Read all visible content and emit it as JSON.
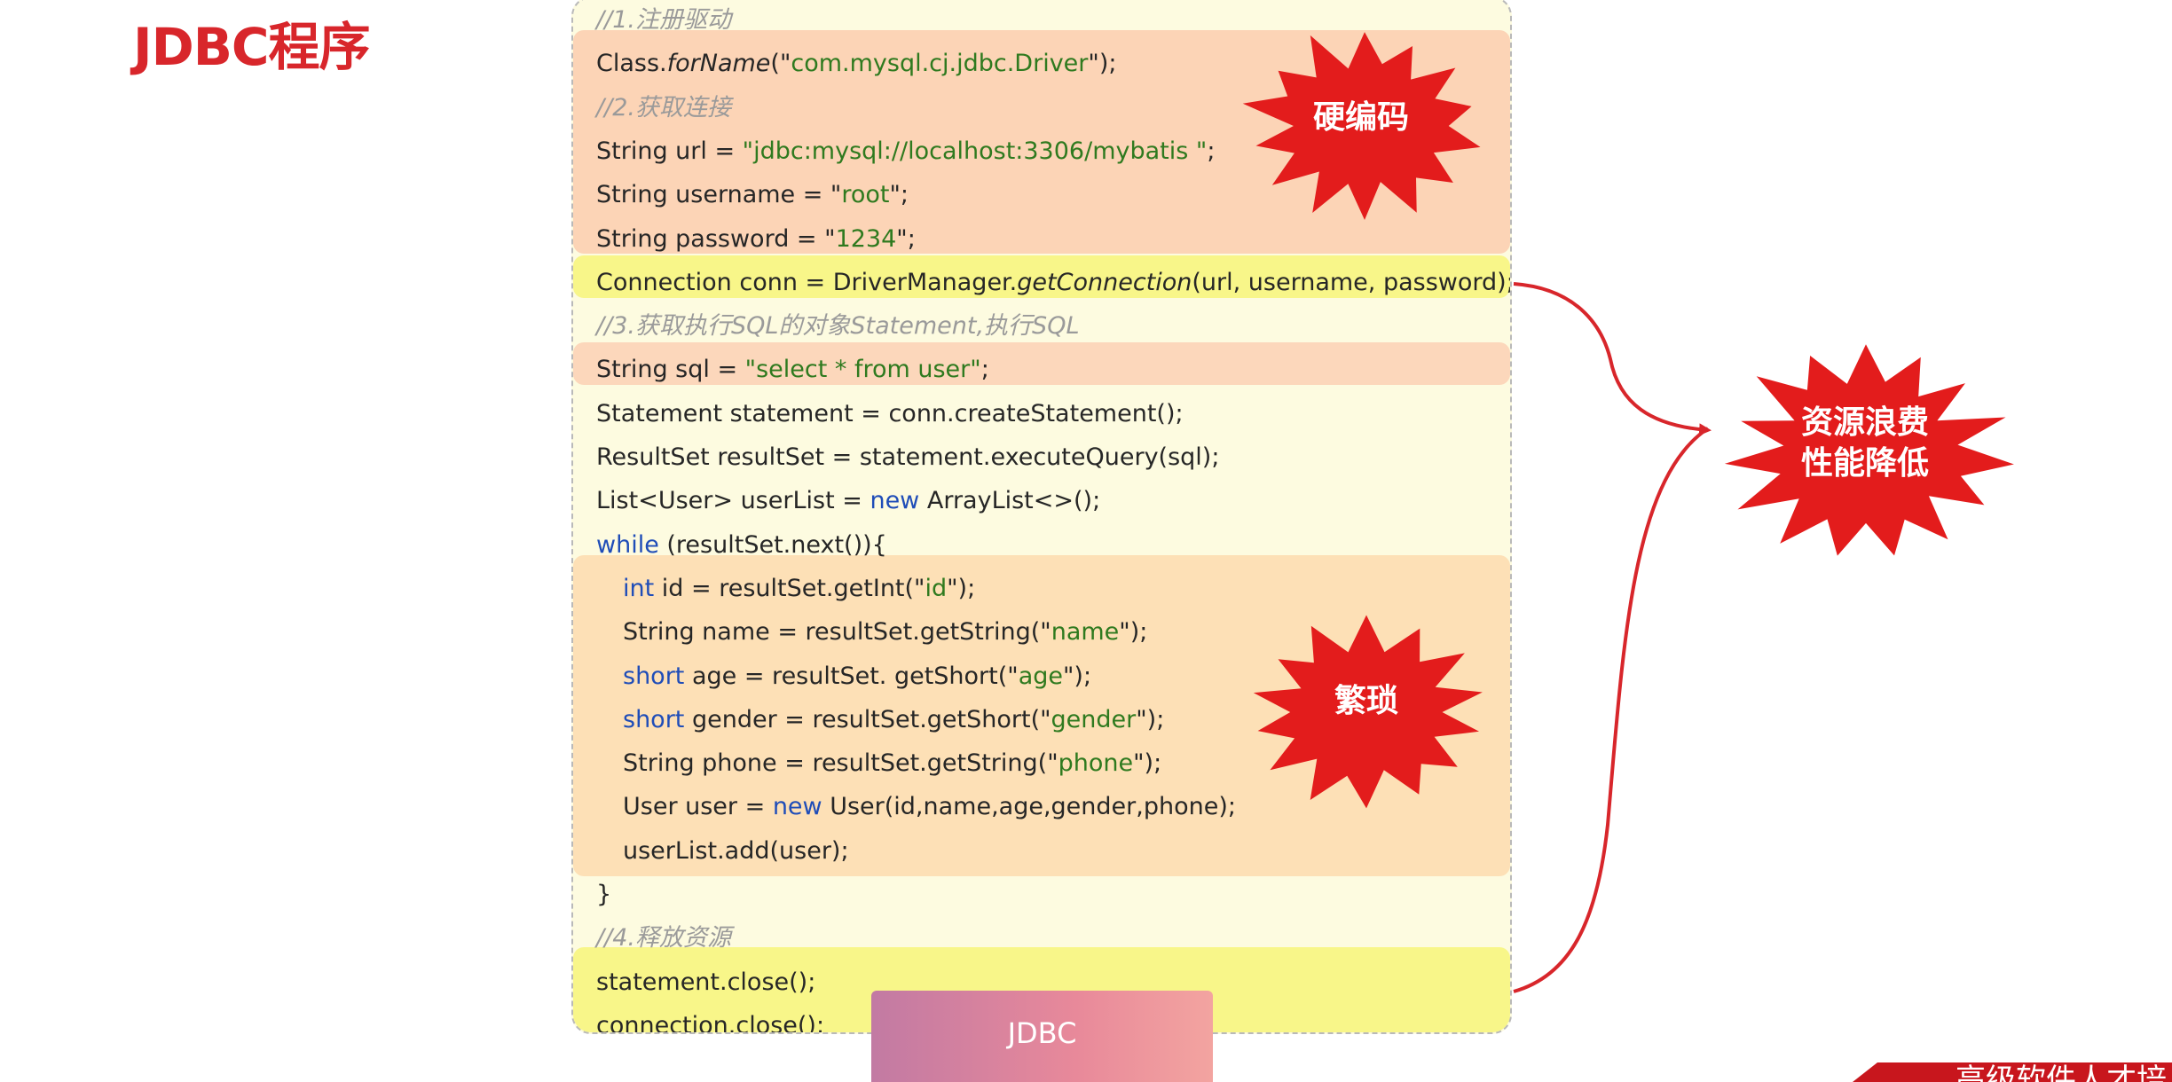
{
  "page": {
    "title": "JDBC程序"
  },
  "code": {
    "lines": [
      {
        "text": "//1.注册驱动",
        "type": "comment"
      },
      {
        "parts": [
          {
            "t": "Class."
          },
          {
            "t": "forName",
            "c": "it"
          },
          {
            "t": "(\""
          },
          {
            "t": "com.mysql.cj.jdbc.Driver",
            "c": "str"
          },
          {
            "t": "\");"
          }
        ]
      },
      {
        "text": "//2.获取连接",
        "type": "comment"
      },
      {
        "parts": [
          {
            "t": "String url = "
          },
          {
            "t": "\"jdbc:mysql://localhost:3306/mybatis \"",
            "c": "str"
          },
          {
            "t": ";"
          }
        ]
      },
      {
        "parts": [
          {
            "t": "String username = \""
          },
          {
            "t": "root",
            "c": "str"
          },
          {
            "t": "\";"
          }
        ]
      },
      {
        "parts": [
          {
            "t": "String password = \""
          },
          {
            "t": "1234",
            "c": "str"
          },
          {
            "t": "\";"
          }
        ]
      },
      {
        "parts": [
          {
            "t": "Connection conn = DriverManager."
          },
          {
            "t": "getConnection",
            "c": "it"
          },
          {
            "t": "(url, username, password);"
          }
        ]
      },
      {
        "text": "//3.获取执行SQL的对象Statement,执行SQL",
        "type": "comment"
      },
      {
        "parts": [
          {
            "t": "String sql = "
          },
          {
            "t": "\"select * from user\"",
            "c": "str"
          },
          {
            "t": ";"
          }
        ]
      },
      {
        "parts": [
          {
            "t": "Statement statement = conn.createStatement();"
          }
        ]
      },
      {
        "parts": [
          {
            "t": "ResultSet resultSet = statement.executeQuery(sql);"
          }
        ]
      },
      {
        "parts": [
          {
            "t": "List<User> userList = "
          },
          {
            "t": "new",
            "c": "kw"
          },
          {
            "t": " ArrayList<>();"
          }
        ]
      },
      {
        "parts": [
          {
            "t": "while",
            "c": "kw"
          },
          {
            "t": " (resultSet.next()){"
          }
        ]
      },
      {
        "indent": true,
        "parts": [
          {
            "t": "int",
            "c": "kw"
          },
          {
            "t": " id = resultSet.getInt(\""
          },
          {
            "t": "id",
            "c": "str"
          },
          {
            "t": "\");"
          }
        ]
      },
      {
        "indent": true,
        "parts": [
          {
            "t": "String name = resultSet.getString(\""
          },
          {
            "t": "name",
            "c": "str"
          },
          {
            "t": "\");"
          }
        ]
      },
      {
        "indent": true,
        "parts": [
          {
            "t": "short",
            "c": "kw"
          },
          {
            "t": " age = resultSet. getShort(\""
          },
          {
            "t": "age",
            "c": "str"
          },
          {
            "t": "\");"
          }
        ]
      },
      {
        "indent": true,
        "parts": [
          {
            "t": "short",
            "c": "kw"
          },
          {
            "t": " gender = resultSet.getShort(\""
          },
          {
            "t": "gender",
            "c": "str"
          },
          {
            "t": "\");"
          }
        ]
      },
      {
        "indent": true,
        "parts": [
          {
            "t": "String phone = resultSet.getString(\""
          },
          {
            "t": "phone",
            "c": "str"
          },
          {
            "t": "\");"
          }
        ]
      },
      {
        "indent": true,
        "parts": [
          {
            "t": "User user = "
          },
          {
            "t": "new",
            "c": "kw"
          },
          {
            "t": " User(id,name,age,gender,phone);"
          }
        ]
      },
      {
        "indent": true,
        "parts": [
          {
            "t": "userList.add(user);"
          }
        ]
      },
      {
        "parts": [
          {
            "t": "}"
          }
        ]
      },
      {
        "text": "//4.释放资源",
        "type": "comment"
      },
      {
        "parts": [
          {
            "t": "statement.close();"
          }
        ]
      },
      {
        "parts": [
          {
            "t": "connection.close();"
          }
        ]
      }
    ]
  },
  "callouts": {
    "hardcode": "硬编码",
    "tedious": "繁琐",
    "waste_line1": "资源浪费",
    "waste_line2": "性能降低"
  },
  "tab": {
    "label": "JDBC"
  },
  "corner": {
    "text": "高级软件人才培"
  },
  "colors": {
    "title": "#d8262b",
    "burst": "#e31c1c",
    "connector": "#d8262b",
    "comment": "#9a9a9a",
    "string": "#2f7a1f",
    "keyword": "#1f4db8"
  }
}
